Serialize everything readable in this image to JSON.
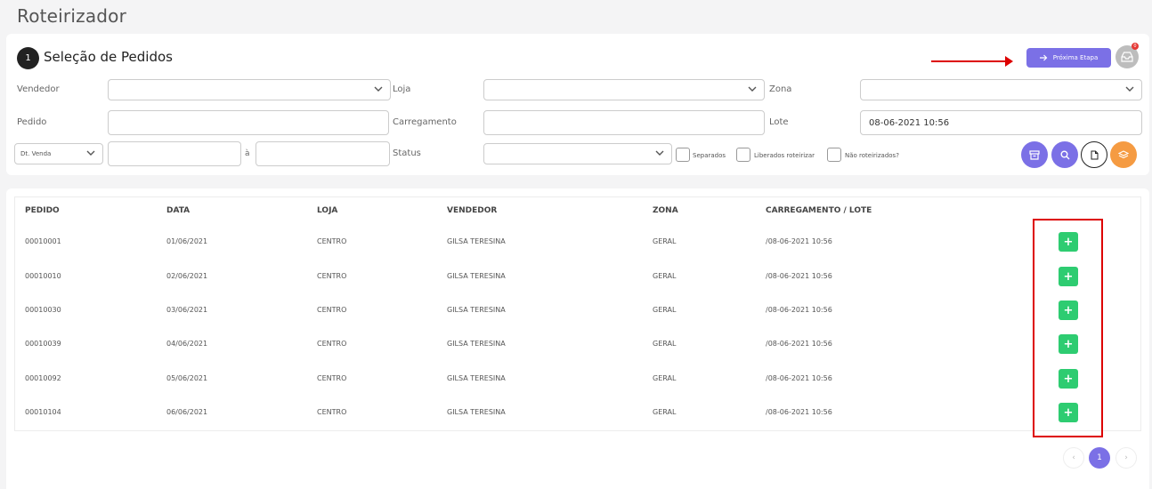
{
  "page": {
    "title": "Roteirizador"
  },
  "step": {
    "number": "1",
    "title": "Seleção de Pedidos"
  },
  "toolbar": {
    "next_label": "Próxima Etapa",
    "badge_count": "0"
  },
  "filters": {
    "vendedor_label": "Vendedor",
    "loja_label": "Loja",
    "zona_label": "Zona",
    "pedido_label": "Pedido",
    "carregamento_label": "Carregamento",
    "lote_label": "Lote",
    "lote_value": "08-06-2021 10:56",
    "date_type_value": "Dt. Venda",
    "date_separator": "à",
    "status_label": "Status",
    "chk_separados": "Separados",
    "chk_liberados": "Liberados roteirizar",
    "chk_nao_roteirizados": "Não roteirizados?"
  },
  "table": {
    "headers": [
      "PEDIDO",
      "DATA",
      "LOJA",
      "VENDEDOR",
      "ZONA",
      "CARREGAMENTO / LOTE"
    ],
    "rows": [
      [
        "00010001",
        "01/06/2021",
        "CENTRO",
        "GILSA TERESINA",
        "GERAL",
        "/08-06-2021 10:56"
      ],
      [
        "00010010",
        "02/06/2021",
        "CENTRO",
        "GILSA TERESINA",
        "GERAL",
        "/08-06-2021 10:56"
      ],
      [
        "00010030",
        "03/06/2021",
        "CENTRO",
        "GILSA TERESINA",
        "GERAL",
        "/08-06-2021 10:56"
      ],
      [
        "00010039",
        "04/06/2021",
        "CENTRO",
        "GILSA TERESINA",
        "GERAL",
        "/08-06-2021 10:56"
      ],
      [
        "00010092",
        "05/06/2021",
        "CENTRO",
        "GILSA TERESINA",
        "GERAL",
        "/08-06-2021 10:56"
      ],
      [
        "00010104",
        "06/06/2021",
        "CENTRO",
        "GILSA TERESINA",
        "GERAL",
        "/08-06-2021 10:56"
      ]
    ],
    "add_label": "+"
  },
  "pagination": {
    "prev": "‹",
    "current": "1",
    "next": "›"
  },
  "colors": {
    "accent": "#7b70e6",
    "add": "#2ecc71",
    "orange": "#f59b42",
    "annotation": "#dd0000"
  }
}
